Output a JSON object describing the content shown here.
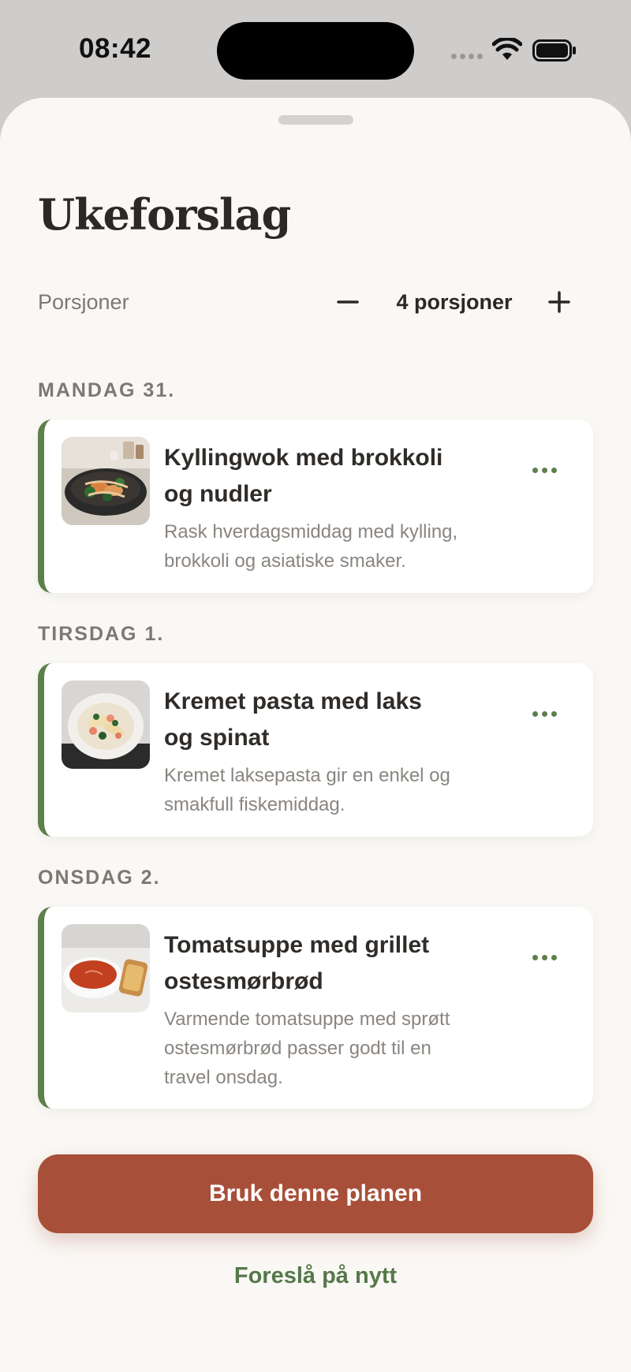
{
  "status_bar": {
    "time": "08:42"
  },
  "sheet": {
    "title": "Ukeforslag",
    "portions": {
      "label": "Porsjoner",
      "value": "4 porsjoner"
    },
    "days": [
      {
        "label": "MANDAG 31.",
        "meal": {
          "title_line1": "Kyllingwok med brokkoli",
          "title_line2": "og nudler",
          "desc_lines": [
            "Rask hverdagsmiddag med kylling,",
            "brokkoli og asiatiske smaker."
          ],
          "image": "chicken-wok-photo"
        }
      },
      {
        "label": "TIRSDAG 1.",
        "meal": {
          "title_line1": "Kremet pasta med laks",
          "title_line2": "og spinat",
          "desc_lines": [
            "Kremet laksepasta gir en enkel og",
            "smakfull fiskemiddag."
          ],
          "image": "salmon-pasta-photo"
        }
      },
      {
        "label": "ONSDAG 2.",
        "meal": {
          "title_line1": "Tomatsuppe med grillet",
          "title_line2": "ostesmørbrød",
          "desc_lines": [
            "Varmende tomatsuppe med sprøtt",
            "ostesmørbrød passer godt til en",
            "travel onsdag."
          ],
          "image": "tomato-soup-photo"
        }
      }
    ],
    "primary_button": "Bruk denne planen",
    "secondary_link": "Foreslå på nytt"
  },
  "colors": {
    "accent_green": "#5d7f4c",
    "primary_button": "#a84f39",
    "sheet_background": "#faf8f5"
  }
}
